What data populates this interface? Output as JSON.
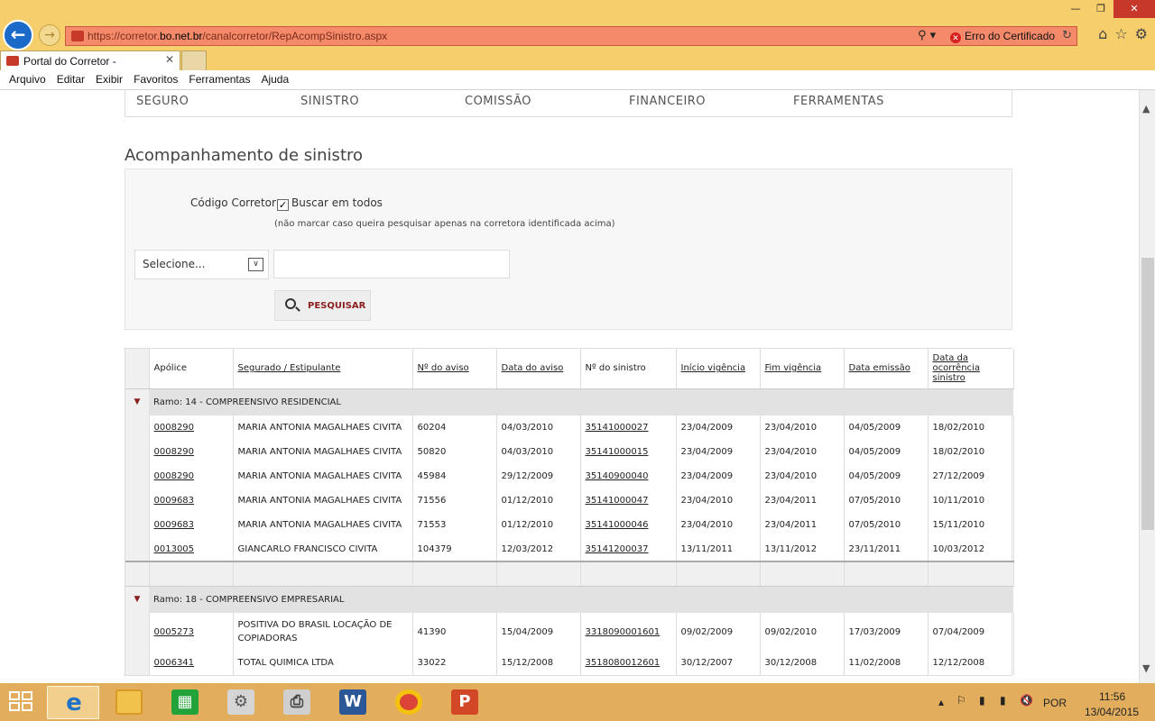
{
  "browser": {
    "url_prefix": "https://corretor.",
    "url_domain": "bo.net.br",
    "url_path": "/canalcorretor/RepAcompSinistro.aspx",
    "cert_error": "Erro do Certificado",
    "tab_title": "Portal do Corretor -",
    "menu": [
      "Arquivo",
      "Editar",
      "Exibir",
      "Favoritos",
      "Ferramentas",
      "Ajuda"
    ]
  },
  "topnav": [
    "SEGURO",
    "SINISTRO",
    "COMISSÃO",
    "FINANCEIRO",
    "FERRAMENTAS"
  ],
  "page_title": "Acompanhamento de sinistro",
  "search": {
    "codigo_label": "Código Corretor",
    "buscar_label": "Buscar em todos",
    "hint": "(não marcar caso queira pesquisar apenas na corretora identificada acima)",
    "select_value": "Selecione...",
    "button_label": "PESQUISAR"
  },
  "table": {
    "headers": [
      "Apólice",
      "Segurado / Estipulante",
      "Nº do aviso",
      "Data do aviso",
      "Nº do sinistro",
      "Início vigência",
      "Fim vigência",
      "Data emissão",
      "Data da ocorrência sinistro"
    ],
    "groups": [
      {
        "label": "Ramo: 14 - COMPREENSIVO RESIDENCIAL",
        "rows": [
          [
            "0008290",
            "MARIA ANTONIA MAGALHAES CIVITA",
            "60204",
            "04/03/2010",
            "35141000027",
            "23/04/2009",
            "23/04/2010",
            "04/05/2009",
            "18/02/2010"
          ],
          [
            "0008290",
            "MARIA ANTONIA MAGALHAES CIVITA",
            "50820",
            "04/03/2010",
            "35141000015",
            "23/04/2009",
            "23/04/2010",
            "04/05/2009",
            "18/02/2010"
          ],
          [
            "0008290",
            "MARIA ANTONIA MAGALHAES CIVITA",
            "45984",
            "29/12/2009",
            "35140900040",
            "23/04/2009",
            "23/04/2010",
            "04/05/2009",
            "27/12/2009"
          ],
          [
            "0009683",
            "MARIA ANTONIA MAGALHAES CIVITA",
            "71556",
            "01/12/2010",
            "35141000047",
            "23/04/2010",
            "23/04/2011",
            "07/05/2010",
            "10/11/2010"
          ],
          [
            "0009683",
            "MARIA ANTONIA MAGALHAES CIVITA",
            "71553",
            "01/12/2010",
            "35141000046",
            "23/04/2010",
            "23/04/2011",
            "07/05/2010",
            "15/11/2010"
          ],
          [
            "0013005",
            "GIANCARLO FRANCISCO CIVITA",
            "104379",
            "12/03/2012",
            "35141200037",
            "13/11/2011",
            "13/11/2012",
            "23/11/2011",
            "10/03/2012"
          ]
        ]
      },
      {
        "label": "Ramo: 18 - COMPREENSIVO EMPRESARIAL",
        "rows": [
          [
            "0005273",
            "POSITIVA DO BRASIL LOCAÇÃO DE COPIADORAS",
            "41390",
            "15/04/2009",
            "3318090001601",
            "09/02/2009",
            "09/02/2010",
            "17/03/2009",
            "07/04/2009"
          ],
          [
            "0006341",
            "TOTAL QUIMICA LTDA",
            "33022",
            "15/12/2008",
            "3518080012601",
            "30/12/2007",
            "30/12/2008",
            "11/02/2008",
            "12/12/2008"
          ]
        ]
      }
    ]
  },
  "taskbar": {
    "language": "POR",
    "time": "11:56",
    "date": "13/04/2015"
  }
}
